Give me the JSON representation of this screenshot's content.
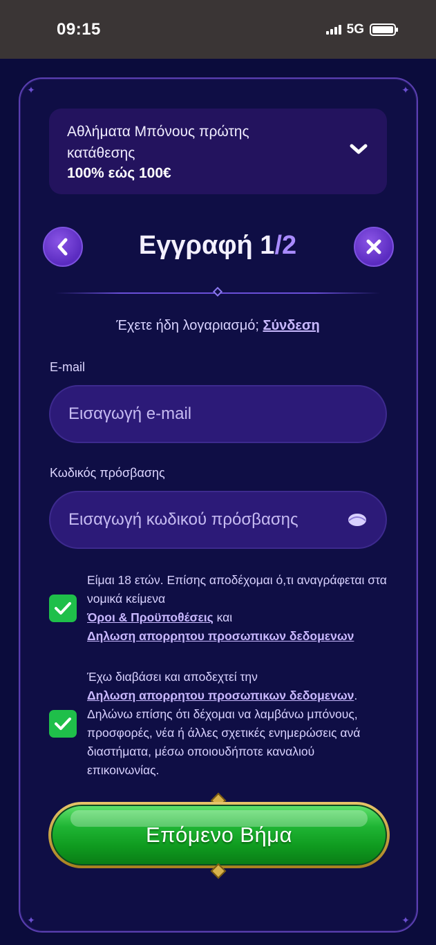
{
  "status_bar": {
    "time": "09:15",
    "network": "5G"
  },
  "bonus": {
    "title": "Αθλήματα Μπόνους πρώτης κατάθεσης",
    "amount": "100% εώς 100€"
  },
  "header": {
    "title": "Εγγραφή 1",
    "step": "/2"
  },
  "login_prompt": {
    "text": "Έχετε ήδη λογαριασμό;",
    "link": "Σύνδεση"
  },
  "email": {
    "label": "E-mail",
    "placeholder": "Εισαγωγή e-mail"
  },
  "password": {
    "label": "Κωδικός πρόσβασης",
    "placeholder": "Εισαγωγή κωδικού πρόσβασης"
  },
  "consent_terms": {
    "checked": true,
    "text": "Είμαι 18 ετών. Επίσης αποδέχομαι ό,τι αναγράφεται στα νομικά κείμενα",
    "terms_link": "Όροι & Προϋποθέσεις",
    "and": "και",
    "privacy_link": "Δηλωση απορρητου προσωπικων δεδομενων"
  },
  "consent_marketing": {
    "checked": true,
    "text_before": "Έχω διαβάσει και αποδεχτεί την",
    "privacy_link": "Δηλωση απορρητου προσωπικων δεδομενων",
    "text_after": ". Δηλώνω επίσης ότι δέχομαι να λαμβάνω μπόνους, προσφορές, νέα ή άλλες σχετικές ενημερώσεις ανά διαστήματα, μέσω οποιουδήποτε καναλιού επικοινωνίας."
  },
  "next_button": {
    "label": "Επόμενο Βήμα"
  },
  "colors": {
    "background": "#0a0b3a",
    "panel": "#23135e",
    "accent": "#7d52e0",
    "checkbox": "#1fbf4a",
    "button_green": "#1fb534",
    "button_gold": "#e6c46a"
  }
}
